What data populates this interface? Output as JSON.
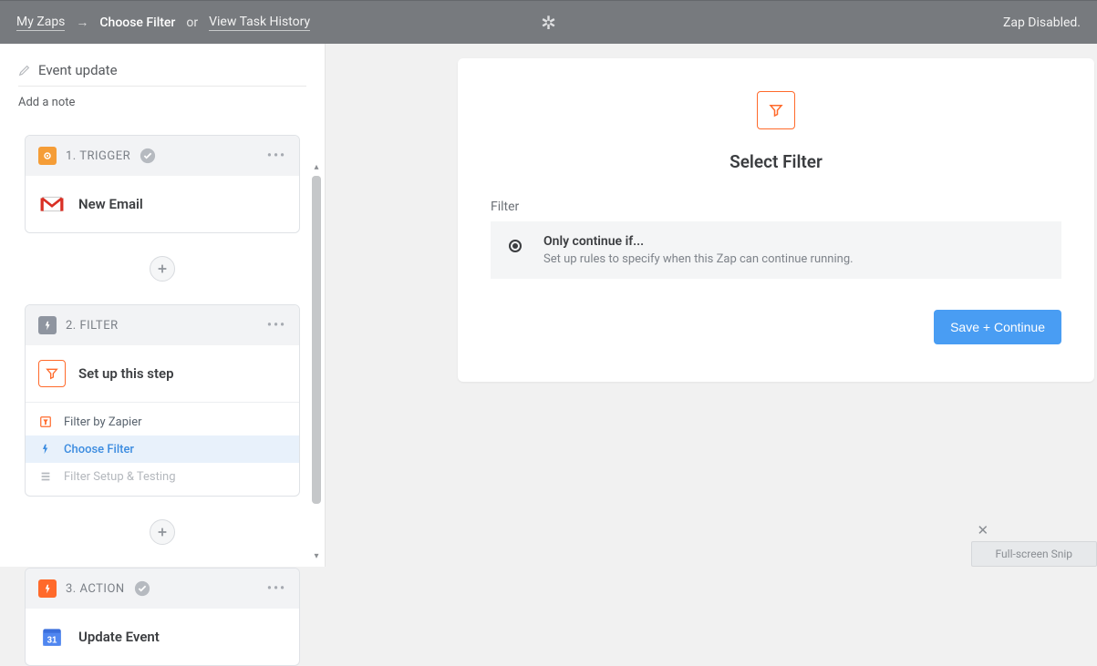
{
  "topbar": {
    "my_zaps": "My Zaps",
    "arrow": "→",
    "current": "Choose Filter",
    "or": "or",
    "history": "View Task History",
    "center_icon": "✲",
    "status": "Zap Disabled."
  },
  "sidebar": {
    "title": "Event update",
    "add_note": "Add a note",
    "steps": [
      {
        "index": "1. TRIGGER",
        "completed": true,
        "icon": "trigger",
        "app_name": "Gmail",
        "app_glyph": "gmail",
        "body_label": "New Email"
      },
      {
        "index": "2. FILTER",
        "completed": false,
        "icon": "filter",
        "app_glyph": "filter",
        "body_label": "Set up this step",
        "substeps": [
          {
            "icon": "filter-box",
            "label": "Filter by Zapier",
            "state": "normal"
          },
          {
            "icon": "bolt",
            "label": "Choose Filter",
            "state": "active"
          },
          {
            "icon": "list",
            "label": "Filter Setup & Testing",
            "state": "disabled"
          }
        ]
      },
      {
        "index": "3. ACTION",
        "completed": true,
        "icon": "action",
        "app_glyph": "calendar",
        "body_label": "Update Event"
      }
    ]
  },
  "panel": {
    "heading": "Select Filter",
    "section_label": "Filter",
    "option": {
      "title": "Only continue if...",
      "desc": "Set up rules to specify when this Zap can continue running."
    },
    "save_label": "Save + Continue"
  },
  "snip": {
    "label": "Full-screen Snip",
    "close": "✕"
  }
}
